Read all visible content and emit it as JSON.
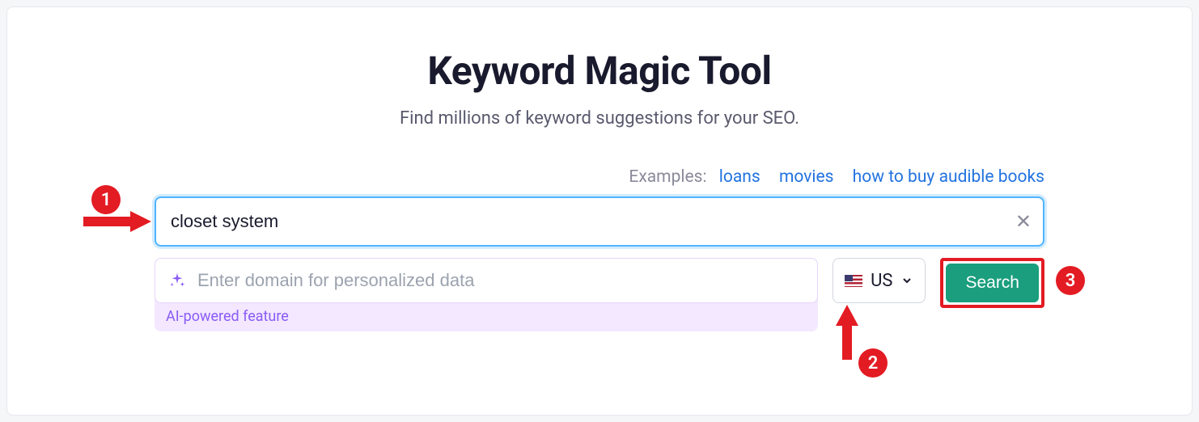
{
  "header": {
    "title": "Keyword Magic Tool",
    "subtitle": "Find millions of keyword suggestions for your SEO."
  },
  "examples": {
    "label": "Examples:",
    "items": [
      "loans",
      "movies",
      "how to buy audible books"
    ]
  },
  "search": {
    "value": "closet system",
    "clear_symbol": "✕"
  },
  "domain": {
    "placeholder": "Enter domain for personalized data",
    "ai_label": "AI-powered feature"
  },
  "country": {
    "code": "US"
  },
  "search_button": {
    "label": "Search"
  },
  "annotations": {
    "badge1": "1",
    "badge2": "2",
    "badge3": "3"
  }
}
